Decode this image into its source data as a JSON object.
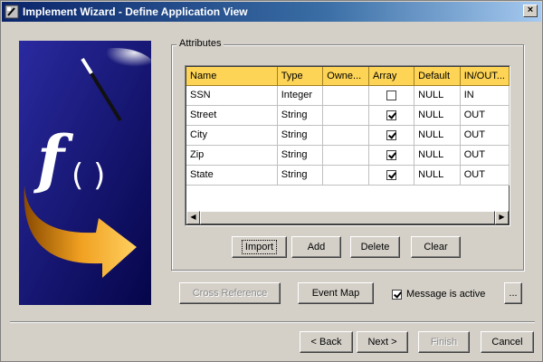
{
  "window": {
    "title": "Implement Wizard - Define Application View"
  },
  "attributes": {
    "group_label": "Attributes",
    "columns": [
      "Name",
      "Type",
      "Owne...",
      "Array",
      "Default",
      "IN/OUT..."
    ],
    "rows": [
      {
        "name": "SSN",
        "type": "Integer",
        "owner": "",
        "array": false,
        "default": "NULL",
        "inout": "IN"
      },
      {
        "name": "Street",
        "type": "String",
        "owner": "",
        "array": true,
        "default": "NULL",
        "inout": "OUT"
      },
      {
        "name": "City",
        "type": "String",
        "owner": "",
        "array": true,
        "default": "NULL",
        "inout": "OUT"
      },
      {
        "name": "Zip",
        "type": "String",
        "owner": "",
        "array": true,
        "default": "NULL",
        "inout": "OUT"
      },
      {
        "name": "State",
        "type": "String",
        "owner": "",
        "array": true,
        "default": "NULL",
        "inout": "OUT"
      }
    ],
    "buttons": {
      "import": "Import",
      "add": "Add",
      "delete": "Delete",
      "clear": "Clear"
    }
  },
  "actions": {
    "cross_reference": "Cross Reference",
    "event_map": "Event Map",
    "message_active_label": "Message is active",
    "message_active_checked": true,
    "ellipsis": "..."
  },
  "nav": {
    "back": "< Back",
    "next": "Next >",
    "finish": "Finish",
    "cancel": "Cancel"
  },
  "colors": {
    "header": "#fdd455",
    "title_start": "#0a246a",
    "art_bg": "#0f0f6e"
  }
}
